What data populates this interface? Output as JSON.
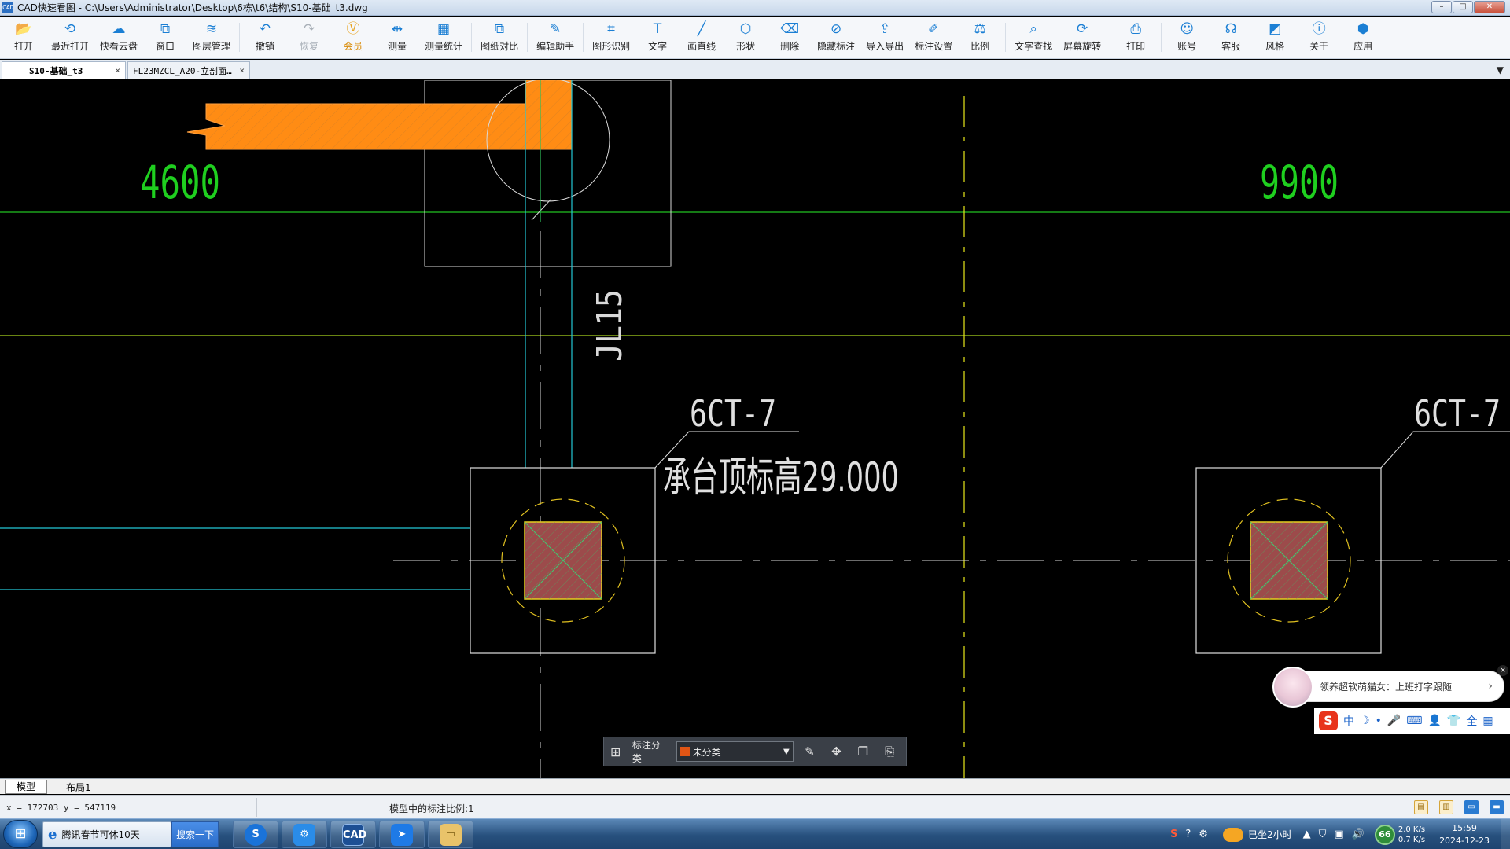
{
  "window": {
    "title": "CAD快速看图 - C:\\Users\\Administrator\\Desktop\\6栋\\t6\\结构\\S10-基础_t3.dwg",
    "app_icon_text": "CAD"
  },
  "toolbar": {
    "items": [
      {
        "label": "打开",
        "icon": "folder-open-icon"
      },
      {
        "label": "最近打开",
        "icon": "recent-icon"
      },
      {
        "label": "快看云盘",
        "icon": "cloud-icon"
      },
      {
        "label": "窗口",
        "icon": "window-icon"
      },
      {
        "label": "图层管理",
        "icon": "layers-icon"
      },
      {
        "label": "撤销",
        "icon": "undo-icon"
      },
      {
        "label": "恢复",
        "icon": "redo-icon"
      },
      {
        "label": "会员",
        "icon": "vip-icon"
      },
      {
        "label": "测量",
        "icon": "measure-icon"
      },
      {
        "label": "测量统计",
        "icon": "measure-stats-icon"
      },
      {
        "label": "图纸对比",
        "icon": "compare-icon"
      },
      {
        "label": "编辑助手",
        "icon": "edit-assistant-icon"
      },
      {
        "label": "图形识别",
        "icon": "shape-recognize-icon"
      },
      {
        "label": "文字",
        "icon": "text-icon"
      },
      {
        "label": "画直线",
        "icon": "line-icon"
      },
      {
        "label": "形状",
        "icon": "shape-icon"
      },
      {
        "label": "删除",
        "icon": "eraser-icon"
      },
      {
        "label": "隐藏标注",
        "icon": "hide-annotation-icon"
      },
      {
        "label": "导入导出",
        "icon": "import-export-icon"
      },
      {
        "label": "标注设置",
        "icon": "annotation-settings-icon"
      },
      {
        "label": "比例",
        "icon": "scale-icon"
      },
      {
        "label": "文字查找",
        "icon": "text-search-icon"
      },
      {
        "label": "屏幕旋转",
        "icon": "rotate-screen-icon"
      },
      {
        "label": "打印",
        "icon": "print-icon"
      },
      {
        "label": "账号",
        "icon": "account-icon"
      },
      {
        "label": "客服",
        "icon": "headset-icon"
      },
      {
        "label": "风格",
        "icon": "style-icon"
      },
      {
        "label": "关于",
        "icon": "info-icon"
      },
      {
        "label": "应用",
        "icon": "apps-icon"
      }
    ]
  },
  "tabs": [
    {
      "label": "S10-基础_t3",
      "active": true
    },
    {
      "label": "FL23MZCL_A20-立剖面…",
      "active": false
    }
  ],
  "drawing": {
    "dim_left": "4600",
    "dim_right": "9900",
    "beam_label": "JL15",
    "pile_cap_1": "6CT-7",
    "pile_cap_2": "6CT-7",
    "elevation_note": "承台顶标高29.000"
  },
  "annotation_bar": {
    "label": "标注分类",
    "selected": "未分类",
    "swatch_color": "#e05515"
  },
  "chat_popup": {
    "text": "领养超软萌猫女：上班打字跟随"
  },
  "ime_bar": {
    "logo": "S",
    "items": [
      "中",
      "☽",
      "•",
      "🎤",
      "⌨",
      "👤",
      "👕",
      "全",
      "▦"
    ]
  },
  "layout_tabs": [
    {
      "label": "模型",
      "active": true
    },
    {
      "label": "布局1",
      "active": false
    }
  ],
  "status": {
    "coords": "x = 172703  y = 547119",
    "scale_text": "模型中的标注比例:1"
  },
  "taskbar": {
    "ie_text": "腾讯春节可休10天",
    "search_btn": "搜索一下",
    "weather": "已坐2小时",
    "cpu": "66",
    "net_up": "2.0 K/s",
    "net_down": "0.7 K/s",
    "time": "15:59",
    "date": "2024-12-23"
  }
}
